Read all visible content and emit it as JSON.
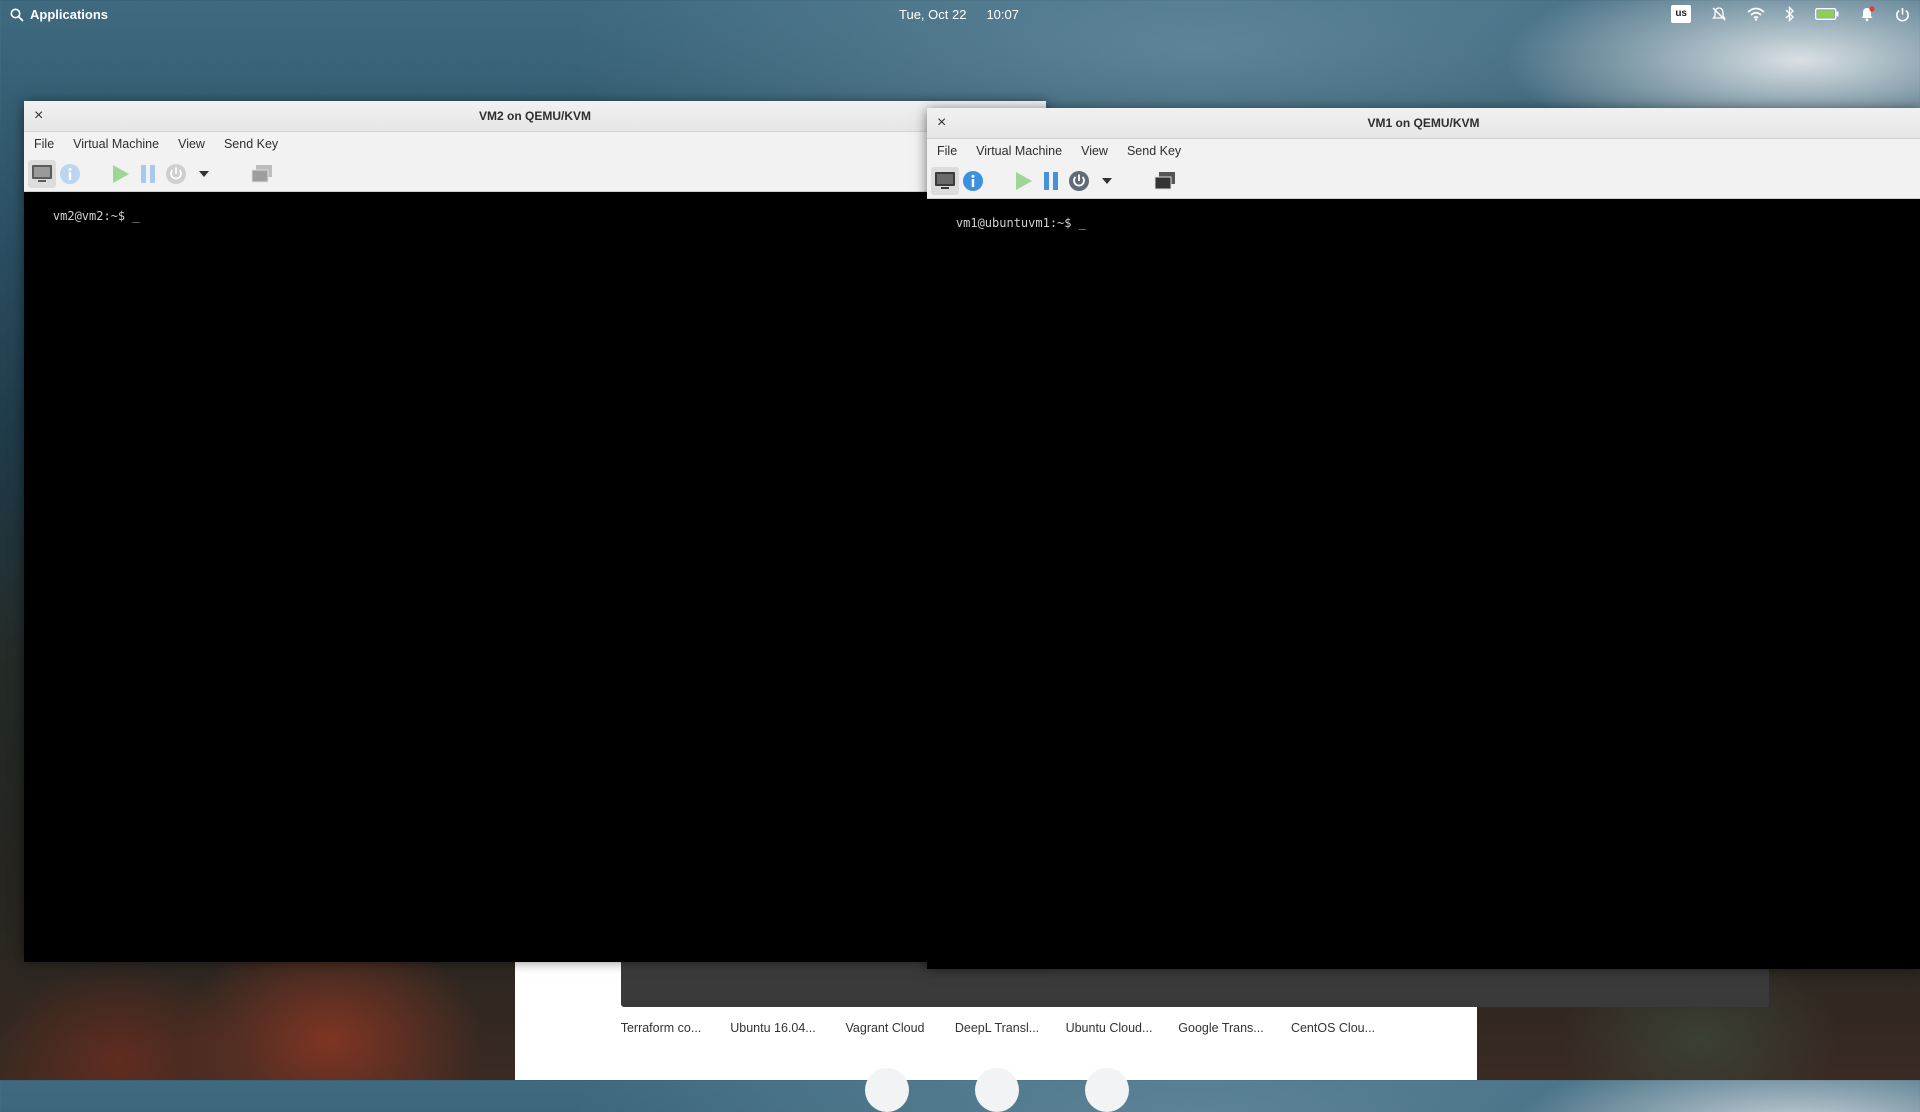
{
  "topbar": {
    "apps_label": "Applications",
    "date": "Tue, Oct 22",
    "time": "10:07",
    "keyboard_layout": "us",
    "tray_icons": [
      "keyboard-layout-icon",
      "notifications-muted-icon",
      "wifi-icon",
      "bluetooth-icon",
      "battery-icon",
      "notification-bell-icon",
      "power-icon"
    ]
  },
  "vm2": {
    "title": "VM2 on QEMU/KVM",
    "close_glyph": "×",
    "menu": [
      "File",
      "Virtual Machine",
      "View",
      "Send Key"
    ],
    "prompt": "vm2@vm2:~$ _"
  },
  "vm1": {
    "title": "VM1 on QEMU/KVM",
    "close_glyph": "×",
    "menu": [
      "File",
      "Virtual Machine",
      "View",
      "Send Key"
    ],
    "prompt": "vm1@ubuntuvm1:~$ _"
  },
  "browser": {
    "shortcuts": [
      "Terraform co...",
      "Ubuntu 16.04...",
      "Vagrant Cloud",
      "DeepL Transl...",
      "Ubuntu Cloud...",
      "Google Trans...",
      "CentOS Clou..."
    ]
  },
  "colors": {
    "play": "#7cc576",
    "pause": "#4a90d9",
    "info": "#3d8fe0"
  }
}
